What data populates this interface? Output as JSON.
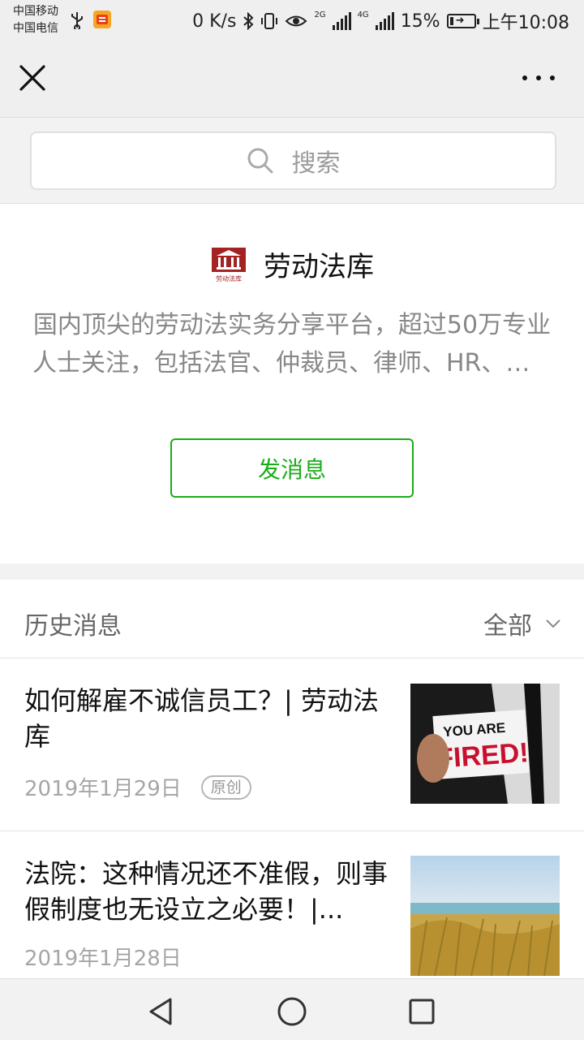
{
  "status_bar": {
    "carrier_1": "中国移动",
    "carrier_2": "中国电信",
    "net_speed": "0 K/s",
    "network_1": "2G",
    "network_2": "4G",
    "battery": "15%",
    "time": "上午10:08",
    "battery_level": 0.15
  },
  "top_bar": {
    "close_icon": "close-icon",
    "more_icon": "more-icon"
  },
  "search": {
    "placeholder": "搜索",
    "icon": "search-icon"
  },
  "account": {
    "name": "劳动法库",
    "logo_text": "劳动法库",
    "description_line1": "国内顶尖的劳动法实务分享平台，超过50万专业",
    "description_line2": "人士关注，包括法官、仲裁员、律师、HR、法...",
    "send_message_label": "发消息",
    "brand_color": "#1aad19",
    "logo_color": "#a32323"
  },
  "history": {
    "title": "历史消息",
    "filter_label": "全部",
    "articles": [
      {
        "title": "如何解雇不诚信员工？| 劳动法库",
        "date": "2019年1月29日",
        "badge": "原创",
        "thumb_line1": "YOU ARE",
        "thumb_line2": "FIRED!"
      },
      {
        "title": "法院：这种情况还不准假，则事假制度也无设立之必要！|...",
        "date": "2019年1月28日",
        "badge": ""
      }
    ]
  },
  "nav_bar": {
    "back_icon": "back-triangle-icon",
    "home_icon": "home-circle-icon",
    "recents_icon": "recents-square-icon"
  }
}
